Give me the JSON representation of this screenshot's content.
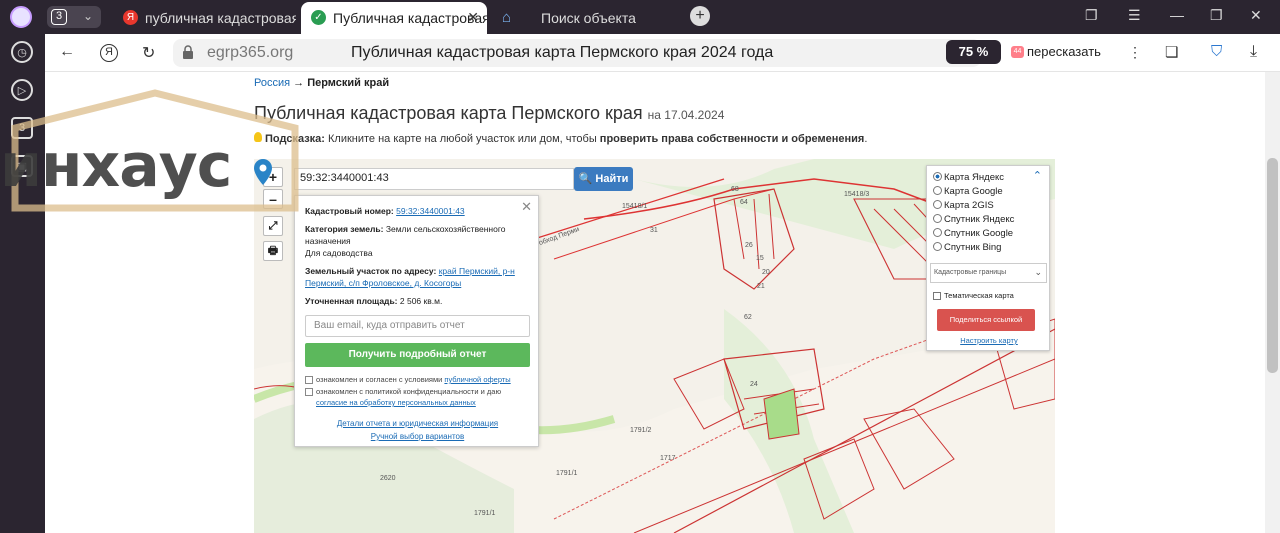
{
  "sidebar": {
    "badge": "3"
  },
  "tabbar": {
    "tab_count": "3",
    "tabs": [
      {
        "label": "публичная кадастровая п",
        "favicon": "Я",
        "active": false
      },
      {
        "label": "Публичная кадастровая",
        "favicon": "✓",
        "active": true
      },
      {
        "label": "Поиск объекта",
        "favicon": "⌂",
        "active": false
      }
    ]
  },
  "addressbar": {
    "domain": "egrp365.org",
    "page_title": "Публичная кадастровая карта Пермского края 2024 года",
    "zoom": "75 %",
    "retell_label": "пересказать",
    "retell_badge": "44"
  },
  "page": {
    "breadcrumb_home": "Россия",
    "breadcrumb_sep": "→",
    "breadcrumb_current": "Пермский край",
    "heading": "Публичная кадастровая карта Пермского края",
    "heading_date": "на 17.04.2024",
    "hint_label": "Подсказка:",
    "hint_text": "Кликните на карте на любой участок или дом, чтобы",
    "hint_bold": "проверить права собственности и обременения",
    "hint_end": "."
  },
  "map": {
    "zoom_in": "+",
    "zoom_out": "–",
    "fullscreen": "⤢",
    "print": "🖶",
    "search_value": "59:32:3440001:43",
    "find_label": "Найти",
    "popup": {
      "cad_label": "Кадастровый номер:",
      "cad_value": "59:32:3440001:43",
      "category_label": "Категория земель:",
      "category_value": "Земли сельскохозяйственного назначения",
      "use_value": "Для садоводства",
      "address_label": "Земельный участок по адресу:",
      "address_value": "край Пермский, р-н Пермский, с/п Фроловское, д. Косогоры",
      "area_label": "Уточненная площадь:",
      "area_value": "2 506 кв.м.",
      "email_placeholder": "Ваш email, куда отправить отчет",
      "report_button": "Получить подробный отчет",
      "agree1_text": "ознакомлен и согласен с условиями",
      "agree1_link": "публичной оферты",
      "agree2_text": "ознакомлен с политикой конфиденциальности и даю",
      "agree2_link": "согласие на обработку персональных данных",
      "details_link": "Детали отчета и юридическая информация",
      "manual_link": "Ручной выбор вариантов"
    },
    "layers": {
      "options": [
        "Карта Яндекс",
        "Карта Google",
        "Карта 2GIS",
        "Спутник Яндекс",
        "Спутник Google",
        "Спутник Bing"
      ],
      "selected": 0,
      "boundaries": "Кадастровые границы",
      "thematic": "Тематическая карта",
      "share": "Поделиться ссылкой",
      "customize": "Настроить карту"
    },
    "labels": [
      "68",
      "15418/3",
      "15418/1",
      "31",
      "64",
      "26",
      "15",
      "20",
      "21",
      "62",
      "24",
      "1791/2",
      "1717",
      "1791/1",
      "2620",
      "1791/1",
      "обход Перми"
    ]
  },
  "watermark": {
    "text": "инхаус"
  }
}
